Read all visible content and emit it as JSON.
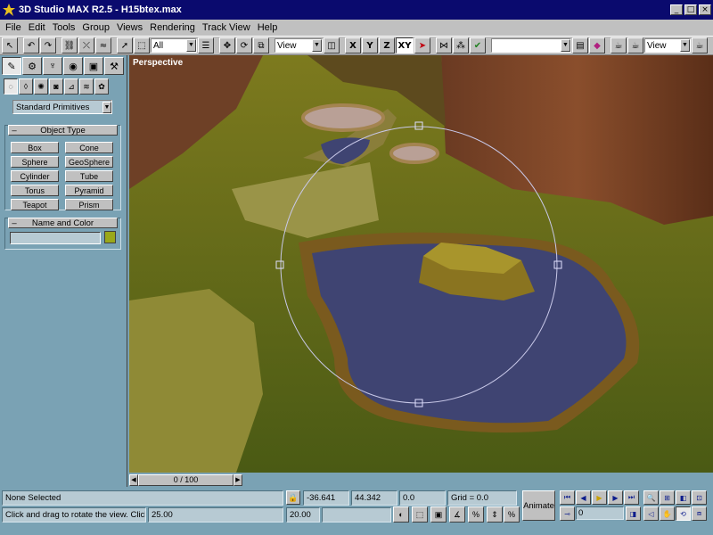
{
  "titlebar": {
    "title": "3D Studio MAX R2.5 - H15btex.max"
  },
  "menus": [
    "File",
    "Edit",
    "Tools",
    "Group",
    "Views",
    "Rendering",
    "Track View",
    "Help"
  ],
  "toolbar": {
    "selection_filter": "All",
    "ref_coord": "View",
    "axis_x": "X",
    "axis_y": "Y",
    "axis_z": "Z",
    "axis_xy": "XY",
    "named_selection": "",
    "render_view": "View"
  },
  "command_panel": {
    "dropdown": "Standard Primitives",
    "object_type_title": "Object Type",
    "objects": [
      "Box",
      "Cone",
      "Sphere",
      "GeoSphere",
      "Cylinder",
      "Tube",
      "Torus",
      "Pyramid",
      "Teapot",
      "Prism"
    ],
    "name_color_title": "Name and Color",
    "name_value": "",
    "swatch_color": "#9aa81a"
  },
  "viewport": {
    "label": "Perspective",
    "water_color": "#3f4472",
    "terrain_color": "#6a7a20"
  },
  "time_slider": {
    "label": "0 / 100"
  },
  "status": {
    "selection": "None Selected",
    "prompt": "Click and drag to rotate the view.  Clicking",
    "x": "-36.641",
    "y": "44.342",
    "z": "0.0",
    "grid": "Grid = 0.0",
    "val1": "25.00",
    "val2": "20.00",
    "animate": "Animate",
    "frame": "0"
  }
}
